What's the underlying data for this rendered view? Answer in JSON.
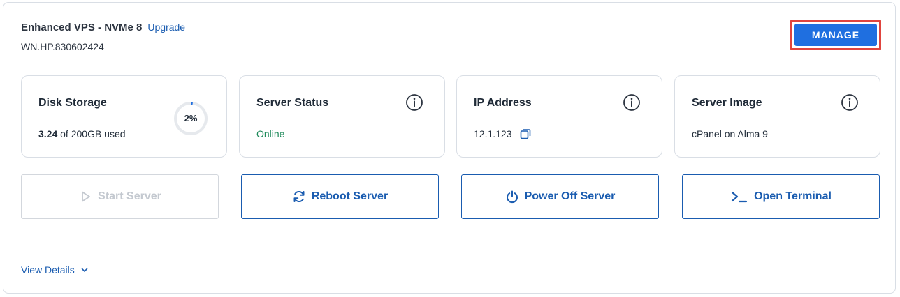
{
  "header": {
    "plan_name": "Enhanced VPS - NVMe 8",
    "upgrade_label": "Upgrade",
    "server_id": "WN.HP.830602424",
    "manage_label": "MANAGE"
  },
  "tiles": {
    "disk": {
      "title": "Disk Storage",
      "used": "3.24",
      "total_text": "of 200GB used",
      "percent_label": "2%",
      "percent": 2
    },
    "status": {
      "title": "Server Status",
      "value": "Online"
    },
    "ip": {
      "title": "IP Address",
      "value": "12.1.123"
    },
    "image": {
      "title": "Server Image",
      "value": "cPanel on Alma 9"
    }
  },
  "actions": {
    "start": "Start Server",
    "reboot": "Reboot Server",
    "power_off": "Power Off Server",
    "terminal": "Open Terminal"
  },
  "footer": {
    "view_details": "View Details"
  },
  "colors": {
    "primary": "#1f6fe0",
    "link": "#1a5cb0",
    "online": "#1e8a5a",
    "highlight": "#e0443e"
  }
}
